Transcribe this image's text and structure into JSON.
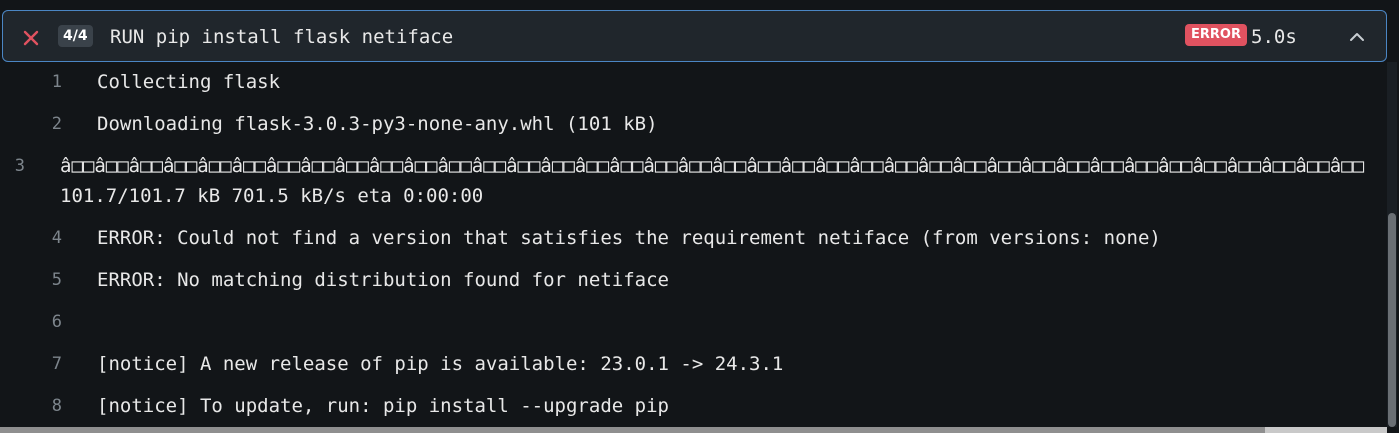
{
  "step": {
    "status_icon": "close-x-icon",
    "count": "4/4",
    "title": "RUN pip install flask netiface",
    "status": "ERROR",
    "duration": "5.0s",
    "collapse_icon": "chevron-up-icon"
  },
  "colors": {
    "error_icon": "#e05260",
    "error_badge": "#e05260",
    "header_border": "#4b86c4",
    "background": "#121518"
  },
  "log": [
    {
      "num": "1",
      "text": "Collecting flask"
    },
    {
      "num": "2",
      "text": "Downloading flask-3.0.3-py3-none-any.whl (101 kB)"
    },
    {
      "num": "3",
      "text": "â□□â□□â□□â□□â□□â□□â□□â□□â□□â□□â□□â□□â□□â□□â□□â□□â□□â□□â□□â□□â□□â□□â□□â□□â□□â□□â□□â□□â□□â□□â□□â□□â□□â□□â□□â□□â□□â□□",
      "text2": "101.7/101.7 kB 701.5 kB/s eta 0:00:00"
    },
    {
      "num": "4",
      "text": "ERROR: Could not find a version that satisfies the requirement netiface (from versions: none)"
    },
    {
      "num": "5",
      "text": "ERROR: No matching distribution found for netiface"
    },
    {
      "num": "6",
      "text": ""
    },
    {
      "num": "7",
      "text": "[notice] A new release of pip is available: 23.0.1 -> 24.3.1"
    },
    {
      "num": "8",
      "text": "[notice] To update, run: pip install --upgrade pip"
    }
  ]
}
